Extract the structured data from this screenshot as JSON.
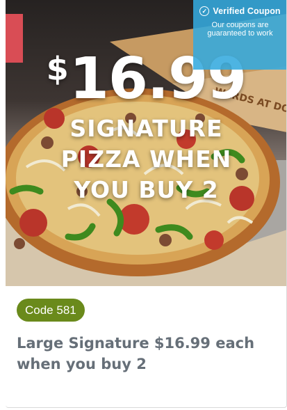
{
  "badge": {
    "icon": "check-circle-icon",
    "title": "Verified Coupon",
    "subtitle": "Our coupons are guaranteed to work"
  },
  "hero": {
    "price_currency": "$",
    "price_amount": "16.99",
    "offer_line1": "SIGNATURE",
    "offer_line2": "PIZZA WHEN",
    "offer_line3": "YOU BUY 2",
    "box_text": "WARDS AT DO"
  },
  "coupon": {
    "code_label": "Code 581",
    "description": "Large Signature $16.99 each when you buy 2",
    "code_color": "#6a8a1b"
  }
}
